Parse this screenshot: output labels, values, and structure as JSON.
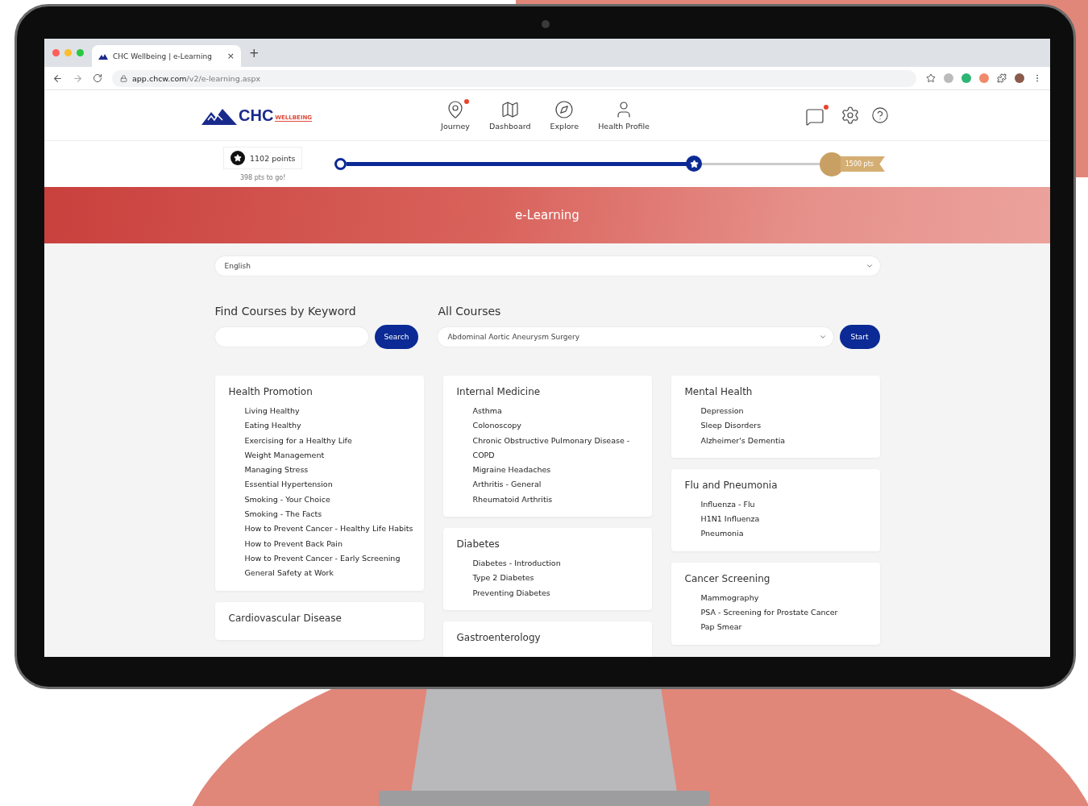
{
  "browser": {
    "tab_title": "CHC Wellbeing | e-Learning",
    "tab_close": "×",
    "new_tab": "+",
    "url_host": "app.chcw.com",
    "url_path": "/v2/e-learning.aspx"
  },
  "header": {
    "logo_main": "CHC",
    "logo_sub": "WELLBEING",
    "nav": [
      {
        "label": "Journey",
        "kind": "pin",
        "alert": true
      },
      {
        "label": "Dashboard",
        "kind": "map",
        "alert": false
      },
      {
        "label": "Explore",
        "kind": "compass",
        "alert": false
      },
      {
        "label": "Health Profile",
        "kind": "person",
        "alert": false
      }
    ],
    "messages_alert": true
  },
  "progress": {
    "points": "1102 points",
    "to_go": "398 pts to go!",
    "goal": "1500 pts",
    "level": 0.735
  },
  "banner": {
    "title": "e-Learning"
  },
  "language": {
    "value": "English"
  },
  "keyword": {
    "heading": "Find Courses by Keyword",
    "button": "Search"
  },
  "all_courses": {
    "heading": "All Courses",
    "value": "Abdominal Aortic Aneurysm Surgery",
    "button": "Start"
  },
  "columns": [
    [
      {
        "title": "Health Promotion",
        "items": [
          "Living Healthy",
          "Eating Healthy",
          "Exercising for a Healthy Life",
          "Weight Management",
          "Managing Stress",
          "Essential Hypertension",
          "Smoking - Your Choice",
          "Smoking - The Facts",
          "How to Prevent Cancer - Healthy Life Habits",
          "How to Prevent Back Pain",
          "How to Prevent Cancer - Early Screening",
          "General Safety at Work"
        ]
      },
      {
        "title": "Cardiovascular Disease"
      }
    ],
    [
      {
        "title": "Internal Medicine",
        "items": [
          "Asthma",
          "Colonoscopy",
          "Chronic Obstructive Pulmonary Disease - COPD",
          "Migraine Headaches",
          "Arthritis - General",
          "Rheumatoid Arthritis"
        ]
      },
      {
        "title": "Diabetes",
        "items": [
          "Diabetes - Introduction",
          "Type 2 Diabetes",
          "Preventing Diabetes"
        ]
      },
      {
        "title": "Gastroenterology"
      }
    ],
    [
      {
        "title": "Mental Health",
        "items": [
          "Depression",
          "Sleep Disorders",
          "Alzheimer's Dementia"
        ]
      },
      {
        "title": "Flu and Pneumonia",
        "items": [
          "Influenza - Flu",
          "H1N1 Influenza",
          "Pneumonia"
        ]
      },
      {
        "title": "Cancer Screening",
        "items": [
          "Mammography",
          "PSA - Screening for Prostate Cancer",
          "Pap Smear"
        ]
      }
    ]
  ]
}
